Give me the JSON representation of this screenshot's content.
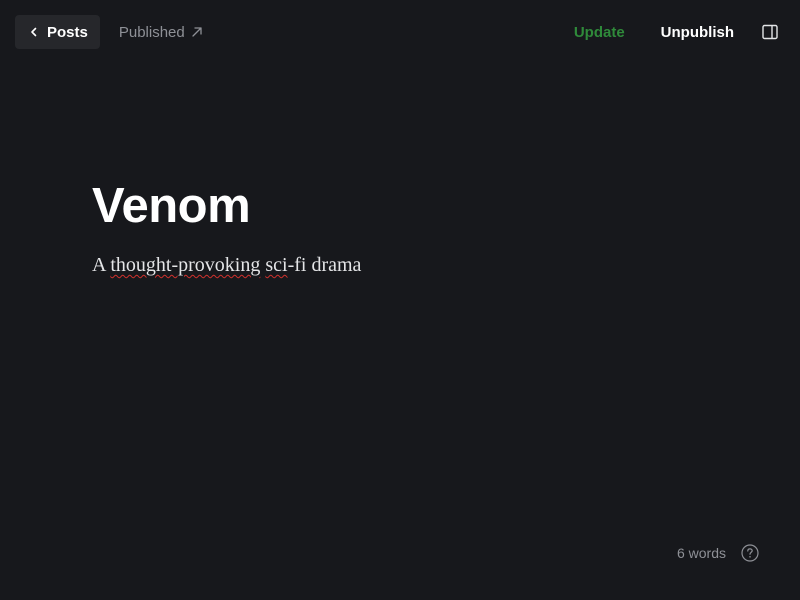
{
  "header": {
    "back_label": "Posts",
    "status_label": "Published",
    "update_label": "Update",
    "unpublish_label": "Unpublish"
  },
  "post": {
    "title": "Venom",
    "excerpt_parts": {
      "p1": "A ",
      "w1": "thought-provoking",
      "p2": " ",
      "w2": "sci",
      "p3": "-fi drama"
    }
  },
  "footer": {
    "word_count": "6 words"
  },
  "icons": {
    "back": "chevron-left-icon",
    "status": "arrow-up-right-icon",
    "sidebar": "sidebar-toggle-icon",
    "help": "help-circle-icon"
  },
  "colors": {
    "background": "#17181c",
    "accent_green": "#2f8a3a",
    "muted_text": "#8e9096",
    "spellcheck": "#d0312d"
  }
}
